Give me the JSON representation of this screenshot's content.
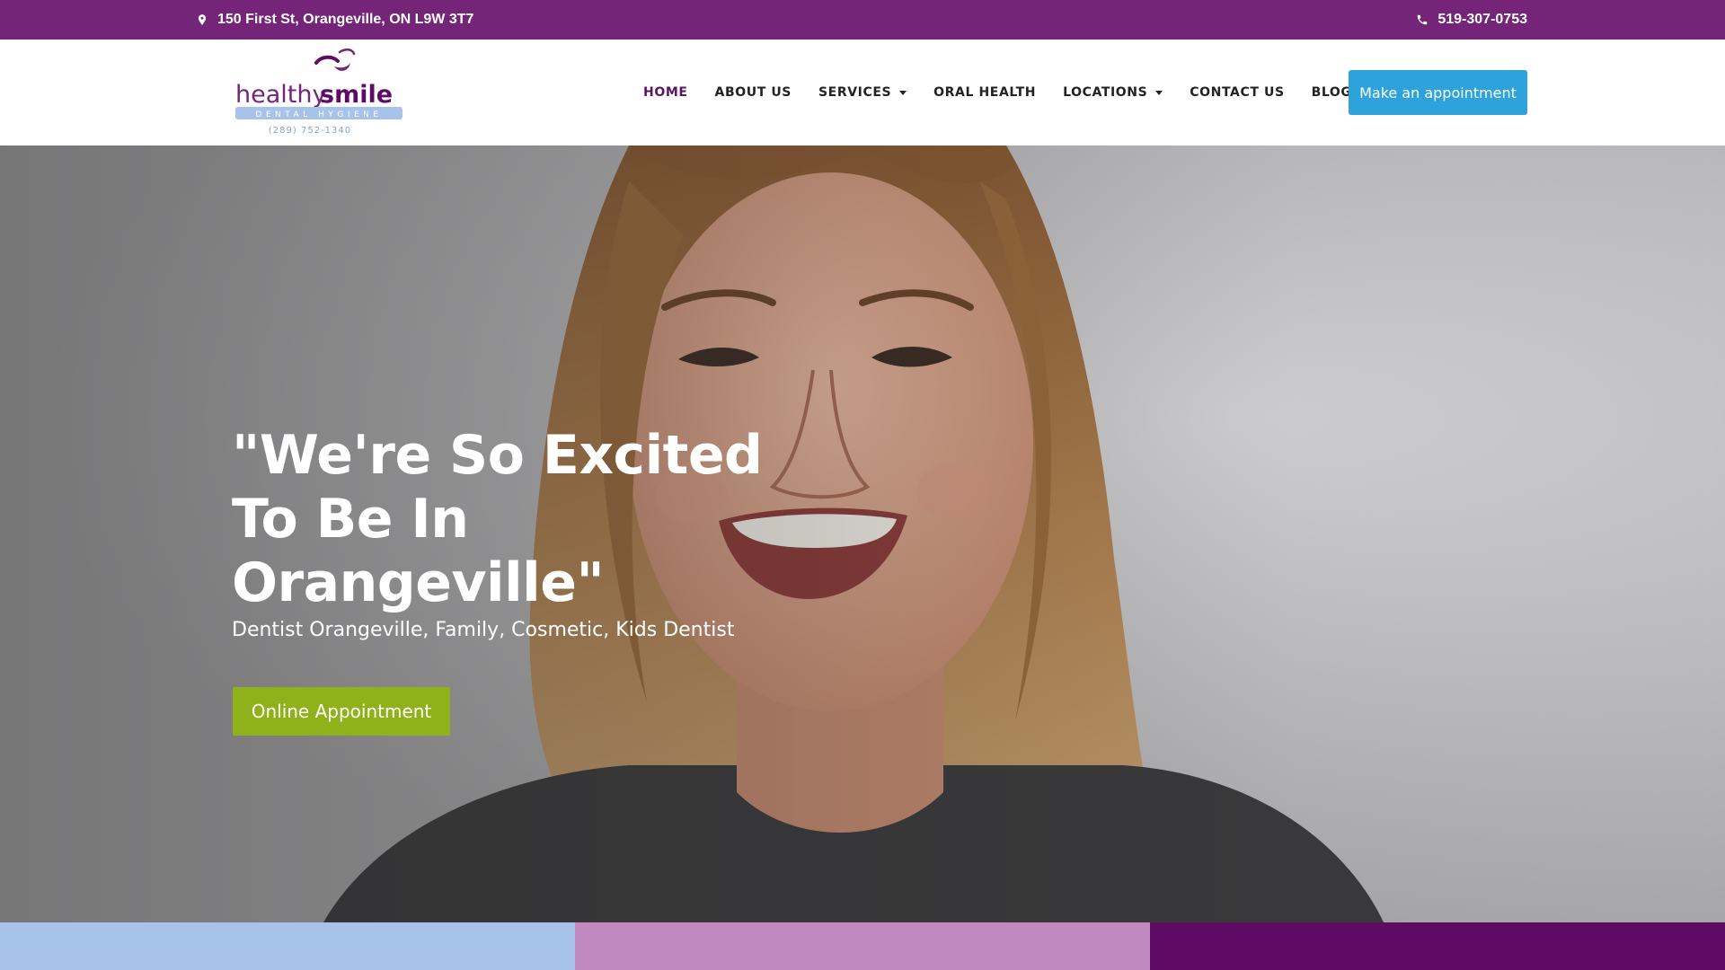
{
  "topbar": {
    "address": "150 First St, Orangeville, ON L9W 3T7",
    "phone": "519-307-0753",
    "address_icon": "map-marker-icon",
    "phone_icon": "phone-icon"
  },
  "logo": {
    "word_light": "healthy",
    "word_bold": "smile",
    "tagline": "DENTAL HYGIENE",
    "phone": "(289) 752-1340"
  },
  "nav": {
    "items": [
      {
        "label": "HOME"
      },
      {
        "label": "ABOUT US"
      },
      {
        "label": "SERVICES"
      },
      {
        "label": "ORAL HEALTH"
      },
      {
        "label": "LOCATIONS"
      },
      {
        "label": "CONTACT US"
      },
      {
        "label": "BLOG"
      }
    ],
    "cta": "Make an appointment"
  },
  "hero": {
    "title_line1": "\"We're So Excited",
    "title_line2": "To Be In",
    "title_line3": "Orangeville\"",
    "subtitle": "Dentist Orangeville, Family, Cosmetic, Kids Dentist",
    "button": "Online Appointment"
  },
  "colors": {
    "topbar": "#742577",
    "nav_active": "#5a1565",
    "cta_blue": "#2ea3db",
    "hero_button_green": "#8fb21b",
    "strip_1": "#a8c3e9",
    "strip_2": "#c089bf",
    "strip_3": "#5f0b66"
  }
}
